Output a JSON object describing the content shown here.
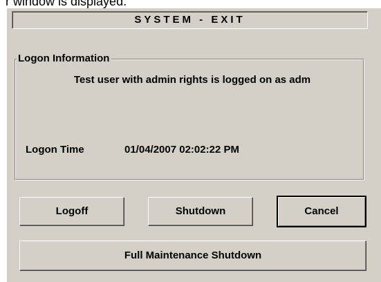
{
  "page_caption": "r window is displayed.",
  "dialog": {
    "title": "SYSTEM - EXIT",
    "group": {
      "label": "Logon Information",
      "message": "Test user with admin rights is logged on as adm",
      "logon_time_label": "Logon Time",
      "logon_time_value": "01/04/2007 02:02:22 PM"
    },
    "buttons": {
      "logoff": "Logoff",
      "shutdown": "Shutdown",
      "cancel": "Cancel",
      "full_maintenance_shutdown": "Full Maintenance Shutdown"
    },
    "colors": {
      "face": "#d4d0c8",
      "highlight": "#ffffff",
      "shadow": "#808080",
      "dark_shadow": "#404040"
    }
  }
}
